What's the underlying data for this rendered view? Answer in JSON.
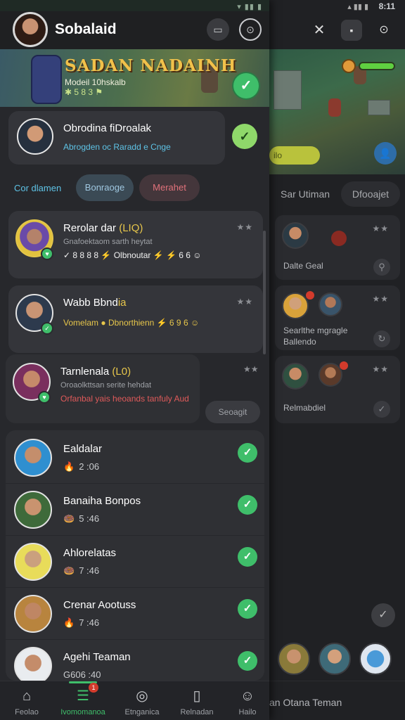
{
  "background": {
    "status": {
      "time": "8:11",
      "signal": "▴ ▮▮ ▮"
    },
    "title": "Sar Utiman",
    "tab_right": "Dfooajet",
    "game_pill": "ilo",
    "cards": [
      {
        "label": "Dalte Geal"
      },
      {
        "label": "Searlthe mgragle Ballendo"
      },
      {
        "label": "Relmabdiel"
      }
    ],
    "bottom_label": "an Otana Teman"
  },
  "status": {
    "signal": "▾ ▮▮ ▮"
  },
  "header": {
    "title": "Sobalaid"
  },
  "banner": {
    "title": "SADAN NADAINH",
    "subtitle": "Modeil 10hskalb",
    "subtitle2": "✱ 5 8 3 ⚑"
  },
  "notification": {
    "name": "Obrodina fiDroalak",
    "detail": "Abrogden oc Raradd e Cnge"
  },
  "filters": {
    "label": "Cor dlamen",
    "chip1": "Bonraoge",
    "chip2": "Merahet"
  },
  "cards": [
    {
      "name": "Rerolar dar",
      "tag": "(LIQ)",
      "sub": "Gnafoektaom sarth heytat",
      "line": "✓ 8 8 8 8 ⚡ Olbnoutar ⚡ ⚡ 6 6 ☺",
      "stars": "★★"
    },
    {
      "name": "Wabb Bbnd",
      "tag": "ia",
      "sub": "",
      "line": "Vomelam ● Dbnorthienn ⚡ 6 9 6 ☺",
      "stars": "★★"
    },
    {
      "name": "Tarnlenala",
      "tag": "(L0)",
      "sub": "Oroaolkttsan serite hehdat",
      "line": "Orfanbal yais heoands tanfuly Aud",
      "stars": "★★"
    }
  ],
  "see_button": "Seoagit",
  "list": [
    {
      "name": "Ealdalar",
      "icon": "🔥",
      "meta": "2 :06"
    },
    {
      "name": "Banaiha Bonpos",
      "icon": "🍩",
      "meta": "5 :46"
    },
    {
      "name": "Ahlorelatas",
      "icon": "🍩",
      "meta": "7 :46"
    },
    {
      "name": "Crenar Aootuss",
      "icon": "🔥",
      "meta": "7 :46"
    },
    {
      "name": "Agehi Teaman",
      "icon": "",
      "meta": "G606 :40"
    }
  ],
  "nav": [
    {
      "label": "Feolao",
      "icon": "⌂"
    },
    {
      "label": "Ivomomanoa",
      "icon": "☰",
      "badge": "1"
    },
    {
      "label": "Etnganica",
      "icon": "◎"
    },
    {
      "label": "Relnadan",
      "icon": "▯"
    },
    {
      "label": "Hailo",
      "icon": "☺"
    }
  ]
}
